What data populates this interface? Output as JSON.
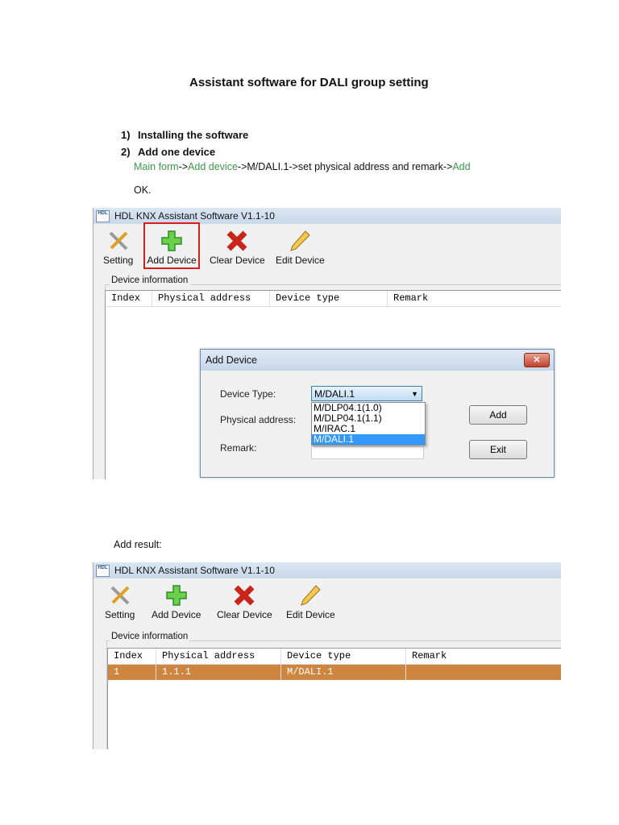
{
  "doc": {
    "title": "Assistant software for DALI group setting",
    "steps": [
      {
        "num": "1)",
        "text": "Installing the software"
      },
      {
        "num": "2)",
        "text": "Add one device"
      }
    ],
    "instruction": {
      "p1": "Main form",
      "a1": "->",
      "p2": "Add device",
      "a2": "->M/DALI.1->set physical address and remark->",
      "p3": "Add"
    },
    "ok": "OK.",
    "add_result": "Add result:"
  },
  "app": {
    "title": "HDL KNX Assistant Software V1.1-10",
    "icon_text": "HDL",
    "toolbar": [
      "Setting",
      "Add Device",
      "Clear Device",
      "Edit Device"
    ],
    "group_label": "Device information",
    "columns": [
      "Index",
      "Physical address",
      "Device type",
      "Remark"
    ]
  },
  "dialog": {
    "title": "Add Device",
    "close": "✕",
    "device_type_label": "Device Type:",
    "physical_label": "Physical address:",
    "remark_label": "Remark:",
    "device_type_value": "M/DALI.1",
    "options": [
      "M/DLP04.1(1.0)",
      "M/DLP04.1(1.1)",
      "M/IRAC.1",
      "M/DALI.1"
    ],
    "add": "Add",
    "exit": "Exit"
  },
  "result": {
    "rows": [
      {
        "index": "1",
        "address": "1.1.1",
        "type": "M/DALI.1",
        "remark": ""
      }
    ]
  },
  "colors": {
    "highlight": "#cd853f",
    "green": "#3a9a4a",
    "callout": "#d62020"
  }
}
